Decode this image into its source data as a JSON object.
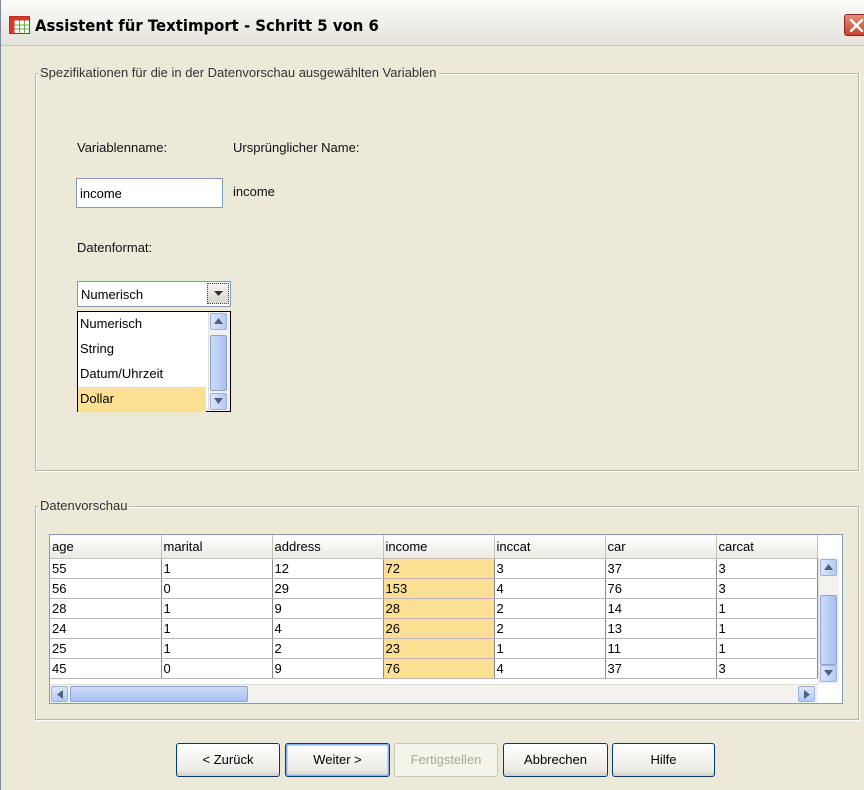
{
  "window": {
    "title": "Assistent für Textimport - Schritt 5 von 6"
  },
  "spec_group": {
    "legend": "Spezifikationen für die in der Datenvorschau ausgewählten Variablen",
    "variable_name_label": "Variablenname:",
    "original_name_label": "Ursprünglicher Name:",
    "variable_name_value": "income",
    "original_name_value": "income",
    "data_format_label": "Datenformat:",
    "data_format_selected": "Numerisch",
    "data_format_options": [
      "Numerisch",
      "String",
      "Datum/Uhrzeit",
      "Dollar"
    ],
    "highlighted_option": "Dollar"
  },
  "preview_group": {
    "legend": "Datenvorschau",
    "columns": [
      "age",
      "marital",
      "address",
      "income",
      "inccat",
      "car",
      "carcat"
    ],
    "rows": [
      [
        "55",
        "1",
        "12",
        "72",
        "3",
        "37",
        "3"
      ],
      [
        "56",
        "0",
        "29",
        "153",
        "4",
        "76",
        "3"
      ],
      [
        "28",
        "1",
        "9",
        "28",
        "2",
        "14",
        "1"
      ],
      [
        "24",
        "1",
        "4",
        "26",
        "2",
        "13",
        "1"
      ],
      [
        "25",
        "1",
        "2",
        "23",
        "1",
        "11",
        "1"
      ],
      [
        "45",
        "0",
        "9",
        "76",
        "4",
        "37",
        "3"
      ]
    ],
    "highlighted_column": "income"
  },
  "buttons": {
    "back": "< Zurück",
    "next": "Weiter >",
    "finish": "Fertigstellen",
    "cancel": "Abbrechen",
    "help": "Hilfe"
  },
  "colors": {
    "selection": "#fbdf93",
    "dialog_bg": "#ece9d8",
    "close_red": "#c5442d"
  }
}
